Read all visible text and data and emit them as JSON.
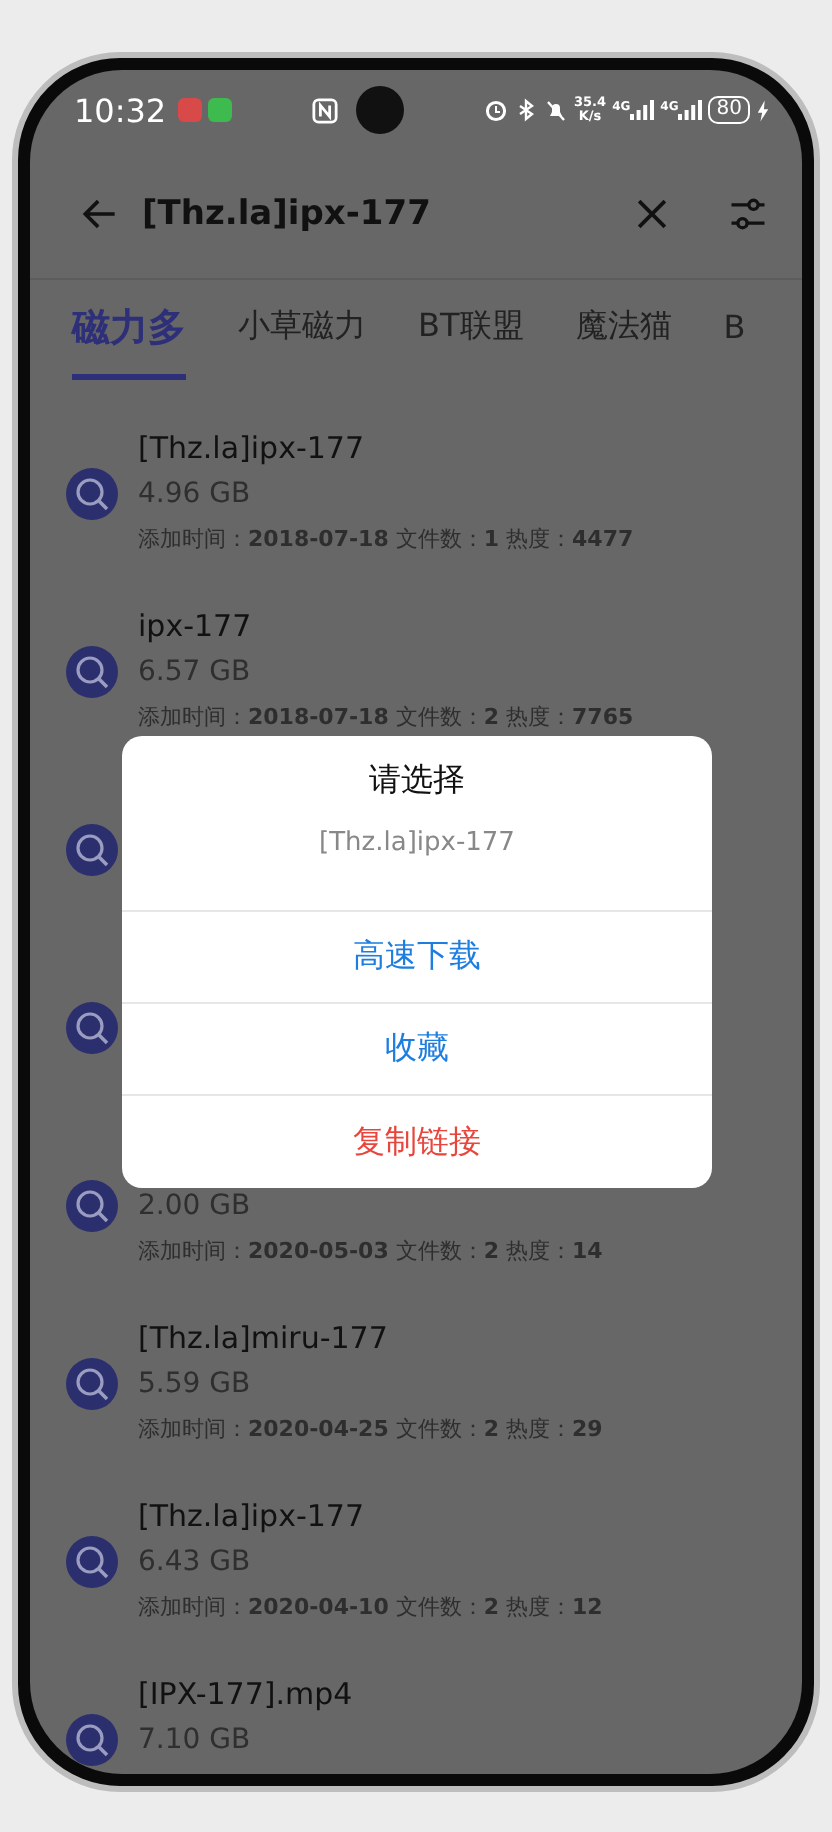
{
  "status_bar": {
    "time": "10:32",
    "net_speed": "35.4",
    "net_unit": "K/s",
    "signal_1": "4G",
    "signal_2": "4G",
    "battery": "80"
  },
  "search": {
    "value": "[Thz.la]ipx-177"
  },
  "tabs": [
    {
      "label": "磁力多",
      "selected": true
    },
    {
      "label": "小草磁力",
      "selected": false
    },
    {
      "label": "BT联盟",
      "selected": false
    },
    {
      "label": "魔法猫",
      "selected": false
    },
    {
      "label": "B",
      "selected": false
    }
  ],
  "results": [
    {
      "kind": "full",
      "title": "[Thz.la]ipx-177",
      "size": "4.96 GB",
      "meta": "添加时间：**2018-07-18** 文件数：**1** 热度：**4477**"
    },
    {
      "kind": "full",
      "title": "ipx-177",
      "size": "6.57 GB",
      "meta": "添加时间：**2018-07-18** 文件数：**2** 热度：**7765**"
    },
    {
      "kind": "covered"
    },
    {
      "kind": "covered"
    },
    {
      "kind": "full",
      "size": "2.00 GB",
      "meta": "添加时间：**2020-05-03** 文件数：**2** 热度：**14**"
    },
    {
      "kind": "full",
      "title": "[Thz.la]miru-177",
      "size": "5.59 GB",
      "meta": "添加时间：**2020-04-25** 文件数：**2** 热度：**29**"
    },
    {
      "kind": "full",
      "title": "[Thz.la]ipx-177",
      "size": "6.43 GB",
      "meta": "添加时间：**2020-04-10** 文件数：**2** 热度：**12**"
    },
    {
      "kind": "full",
      "title": "[IPX-177].mp4",
      "size": "7.10 GB"
    }
  ],
  "dialog": {
    "title": "请选择",
    "subtitle": "[Thz.la]ipx-177",
    "actions": [
      {
        "label": "高速下载",
        "kind": "normal"
      },
      {
        "label": "收藏",
        "kind": "normal"
      },
      {
        "label": "复制链接",
        "kind": "danger"
      }
    ]
  }
}
